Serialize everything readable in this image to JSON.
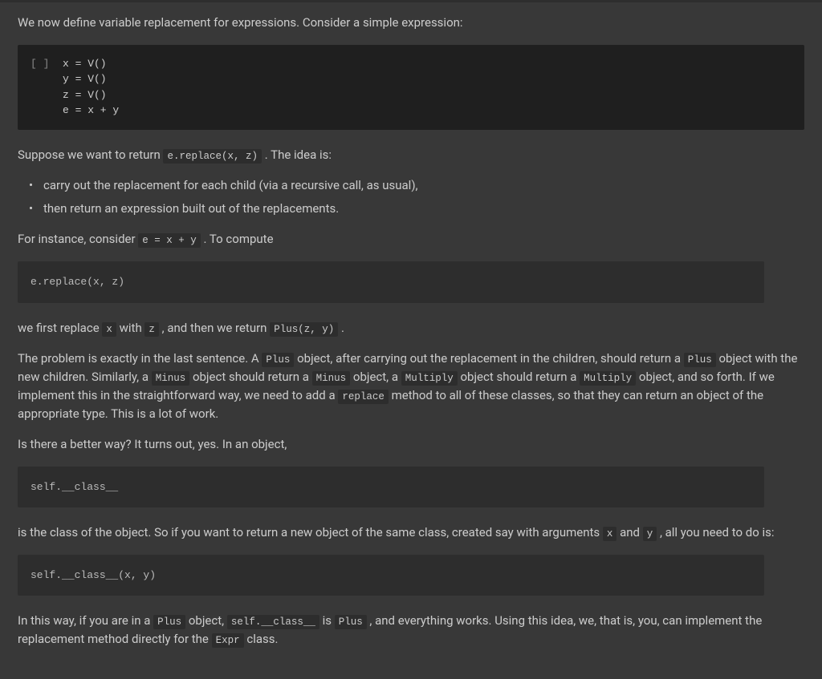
{
  "intro_text": "We now define variable replacement for expressions. Consider a simple expression:",
  "code_cell_1": {
    "prompt": "[ ]",
    "code": "x = V()\ny = V()\nz = V()\ne = x + y"
  },
  "para_suppose_1": "Suppose we want to return ",
  "code_e_replace_xz": "e.replace(x, z)",
  "para_suppose_2": " . The idea is:",
  "bullet_1": "carry out the replacement for each child (via a recursive call, as usual),",
  "bullet_2": "then return an expression built out of the replacements.",
  "para_instance_1": "For instance, consider ",
  "code_e_eq": "e = x + y",
  "para_instance_2": " . To compute",
  "code_block_replace": "e.replace(x, z)",
  "para_first_replace_1": "we first replace ",
  "code_x": "x",
  "para_first_replace_2": " with ",
  "code_z": "z",
  "para_first_replace_3": " , and then we return ",
  "code_plus_zy": "Plus(z, y)",
  "para_first_replace_4": " .",
  "para_problem_1": "The problem is exactly in the last sentence. A ",
  "code_plus_1": "Plus",
  "para_problem_2": " object, after carrying out the replacement in the children, should return a ",
  "code_plus_2": "Plus",
  "para_problem_3": " object with the new children. Similarly, a ",
  "code_minus_1": "Minus",
  "para_problem_4": " object should return a ",
  "code_minus_2": "Minus",
  "para_problem_5": " object, a ",
  "code_multiply_1": "Multiply",
  "para_problem_6": " object should return a ",
  "code_multiply_2": "Multiply",
  "para_problem_7": " object, and so forth. If we implement this in the straightforward way, we need to add a ",
  "code_replace": "replace",
  "para_problem_8": " method to all of these classes, so that they can return an object of the appropriate type. This is a lot of work.",
  "para_better_way": "Is there a better way? It turns out, yes. In an object,",
  "code_block_selfclass": "self.__class__",
  "para_class_1": "is the class of the object. So if you want to return a new object of the same class, created say with arguments ",
  "code_x_2": "x",
  "para_class_2": " and ",
  "code_y": "y",
  "para_class_3": " , all you need to do is:",
  "code_block_selfclass_xy": "self.__class__(x, y)",
  "para_final_1": "In this way, if you are in a ",
  "code_plus_3": "Plus",
  "para_final_2": " object, ",
  "code_selfclass_inline": "self.__class__",
  "para_final_3": " is ",
  "code_plus_4": "Plus",
  "para_final_4": " , and everything works. Using this idea, we, that is, you, can implement the replacement method directly for the ",
  "code_expr": "Expr",
  "para_final_5": " class."
}
